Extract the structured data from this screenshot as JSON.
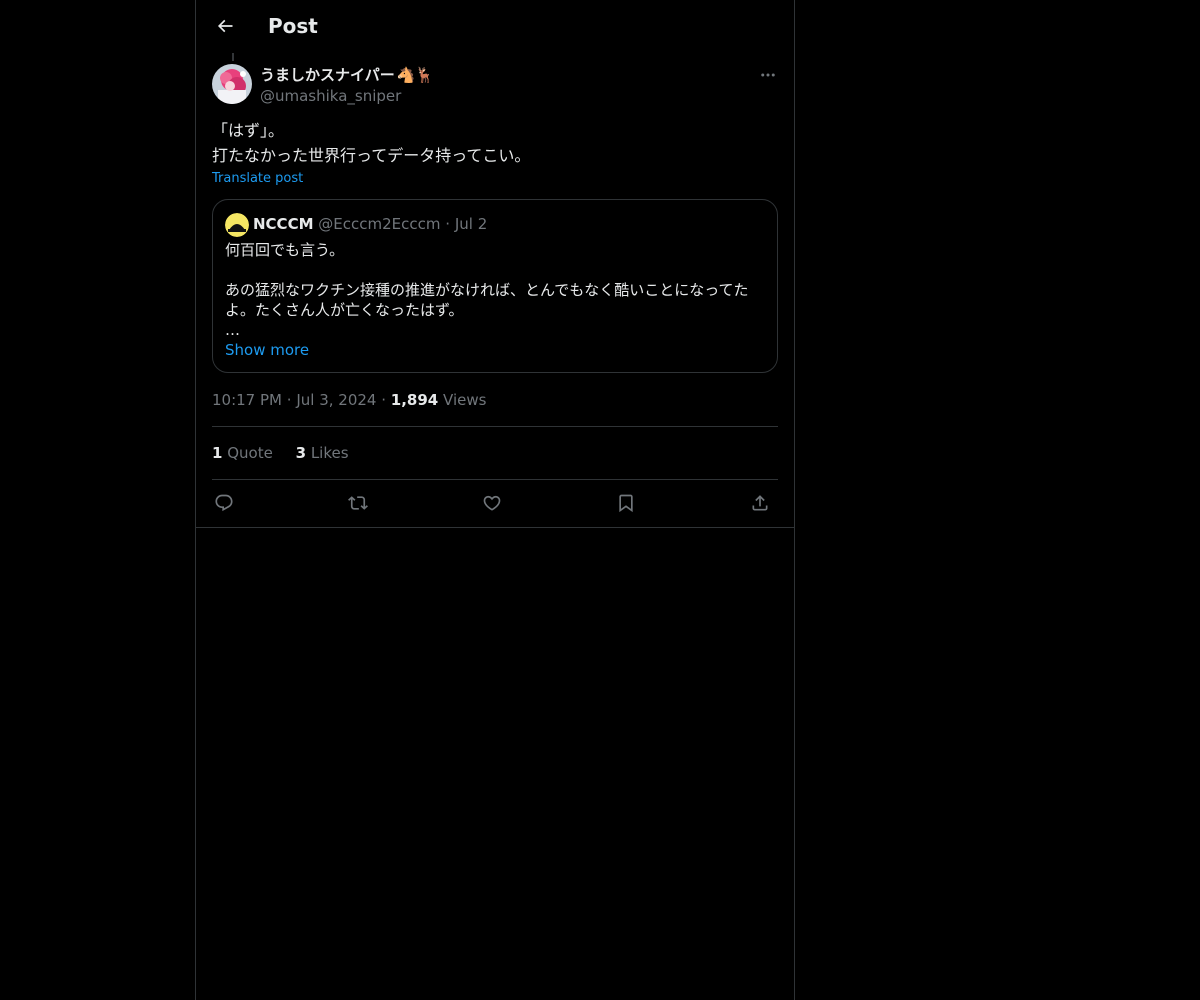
{
  "header": {
    "title": "Post",
    "back_icon": "arrow-left-icon"
  },
  "post": {
    "author": {
      "display_name": "うましかスナイパー",
      "emoji": "🐴🦌",
      "handle": "@umashika_sniper"
    },
    "more_icon": "ellipsis-icon",
    "text_lines": [
      "「はず」。",
      "打たなかった世界行ってデータ持ってこい。"
    ],
    "translate_label": "Translate post",
    "quoted": {
      "display_name": "NCCCM",
      "handle": "@Ecccm2Ecccm",
      "separator": "·",
      "date": "Jul 2",
      "lines": [
        "何百回でも言う。",
        "",
        "あの猛烈なワクチン接種の推進がなければ、とんでもなく酷いことになってた",
        "よ。たくさん人が亡くなったはず。",
        "…"
      ],
      "show_more_label": "Show more"
    },
    "meta": {
      "time": "10:17 PM",
      "sep1": "·",
      "date": "Jul 3, 2024",
      "sep2": "·",
      "views_count": "1,894",
      "views_label": "Views"
    },
    "stats": {
      "quotes_count": "1",
      "quotes_label": "Quote",
      "likes_count": "3",
      "likes_label": "Likes"
    },
    "actions": [
      "reply-icon",
      "repost-icon",
      "like-icon",
      "bookmark-icon",
      "share-icon"
    ]
  },
  "colors": {
    "background": "#000000",
    "text": "#e7e9ea",
    "muted": "#71767b",
    "link": "#1d9bf0",
    "border": "#2f3336"
  }
}
